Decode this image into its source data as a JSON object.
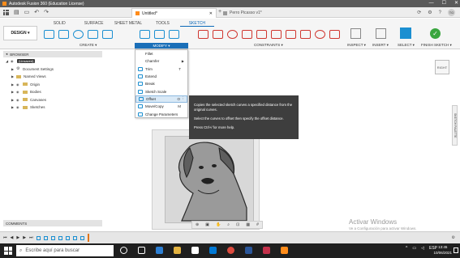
{
  "window": {
    "title": "Autodesk Fusion 360 (Education License)",
    "controls": [
      "—",
      "☐",
      "✕"
    ]
  },
  "tabs": {
    "active_doc": "Untitled*",
    "other_doc": "Perro Picasso v1*",
    "active_close": "✕",
    "add": "+",
    "right_icons": [
      "⟳",
      "⚙",
      "?"
    ],
    "avatar": "TG"
  },
  "toolbar": {
    "workspace": "DESIGN ▾",
    "ribbon_tabs": [
      "SOLID",
      "SURFACE",
      "SHEET METAL",
      "TOOLS",
      "SKETCH"
    ],
    "active_tab": "SKETCH",
    "groups": {
      "create": "CREATE ▾",
      "modify": "MODIFY ▾",
      "constraints": "CONSTRAINTS ▾",
      "inspect": "INSPECT ▾",
      "insert": "INSERT ▾",
      "select": "SELECT ▾",
      "finish": "FINISH SKETCH ▾"
    },
    "finish_icon": "✓"
  },
  "browser": {
    "title": "BROWSER",
    "items": [
      {
        "label": "(Unsaved)",
        "type": "root"
      },
      {
        "label": "Document Settings",
        "type": "gear"
      },
      {
        "label": "Named Views",
        "type": "folder"
      },
      {
        "label": "Origin",
        "type": "folder"
      },
      {
        "label": "Bodies",
        "type": "folder"
      },
      {
        "label": "Canvases",
        "type": "folder"
      },
      {
        "label": "Sketches",
        "type": "folder"
      }
    ]
  },
  "modify_menu": {
    "items": [
      {
        "label": "Fillet",
        "shortcut": "",
        "submenu": false
      },
      {
        "label": "Chamfer",
        "shortcut": "",
        "submenu": true
      },
      {
        "label": "Trim",
        "shortcut": "T",
        "submenu": false
      },
      {
        "label": "Extend",
        "shortcut": "",
        "submenu": false
      },
      {
        "label": "Break",
        "shortcut": "",
        "submenu": false
      },
      {
        "label": "Sketch Scale",
        "shortcut": "",
        "submenu": false
      },
      {
        "label": "Offset",
        "shortcut": "O",
        "submenu": false,
        "highlighted": true
      },
      {
        "label": "Move/Copy",
        "shortcut": "M",
        "submenu": false
      },
      {
        "label": "Change Parameters",
        "shortcut": "",
        "submenu": false
      }
    ],
    "more_icon": "⋮",
    "submenu_icon": "▶"
  },
  "tooltip": {
    "line1": "Copies the selected sketch curves a specified distance from the original curves.",
    "line2": "Select the curves to offset then specify the offset distance.",
    "line3": "Press Ctrl+/ for more help."
  },
  "canvas": {
    "view_cube": "RIGHT",
    "sketch_palette": "SKETCH PALETTE"
  },
  "comments": {
    "label": "COMMENTS"
  },
  "timeline": {
    "controls": [
      "⏮",
      "◀",
      "▶",
      "▶",
      "⏭"
    ]
  },
  "watermark": {
    "title": "Activar Windows",
    "subtitle": "Ve a Configuración para activar Windows."
  },
  "taskbar": {
    "search_placeholder": "Escribe aquí para buscar",
    "language": "ESP",
    "time": "13:45",
    "date": "10/06/2021"
  },
  "colors": {
    "accent": "#1b8fd1",
    "modify_active": "#1b6fb8",
    "finish": "#3aa63f",
    "tooltip_bg": "#3e3e3e",
    "highlight": "#d9e9f6"
  }
}
